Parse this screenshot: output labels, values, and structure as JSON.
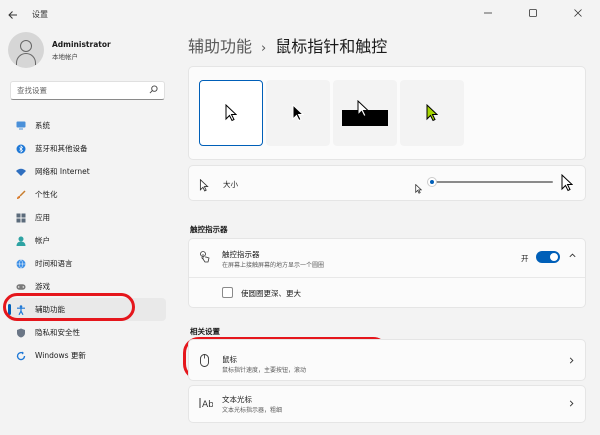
{
  "window": {
    "title": "设置",
    "back_icon": "back-arrow-icon",
    "controls": [
      "minimize-icon",
      "maximize-icon",
      "close-icon"
    ]
  },
  "user": {
    "name": "Administrator",
    "account_type": "本地帐户"
  },
  "search": {
    "placeholder": "查找设置"
  },
  "sidebar": {
    "items": [
      {
        "label": "系统",
        "icon": "system-icon",
        "active": false
      },
      {
        "label": "蓝牙和其他设备",
        "icon": "bluetooth-icon",
        "active": false
      },
      {
        "label": "网络和 Internet",
        "icon": "wifi-icon",
        "active": false
      },
      {
        "label": "个性化",
        "icon": "brush-icon",
        "active": false
      },
      {
        "label": "应用",
        "icon": "apps-icon",
        "active": false
      },
      {
        "label": "帐户",
        "icon": "account-icon",
        "active": false
      },
      {
        "label": "时间和语言",
        "icon": "globe-icon",
        "active": false
      },
      {
        "label": "游戏",
        "icon": "gamepad-icon",
        "active": false
      },
      {
        "label": "辅助功能",
        "icon": "accessibility-icon",
        "active": true
      },
      {
        "label": "隐私和安全性",
        "icon": "shield-icon",
        "active": false
      },
      {
        "label": "Windows 更新",
        "icon": "update-icon",
        "active": false
      }
    ]
  },
  "breadcrumb": {
    "parent": "辅助功能",
    "separator": "›",
    "current": "鼠标指针和触控"
  },
  "cursor_styles": {
    "options": [
      "white-cursor",
      "black-cursor",
      "inverted-cursor",
      "custom-cursor"
    ],
    "selected_index": 0,
    "custom_color": "#a6d600"
  },
  "size": {
    "label": "大小",
    "value_fraction": 0.03
  },
  "touch_indicator_section": {
    "title": "触控指示器",
    "row_title": "触控指示器",
    "row_sub": "在屏幕上接触屏幕的地方显示一个圆圈",
    "toggle_label": "开",
    "toggle_on": true,
    "option_label": "使圆圈更深、更大",
    "option_checked": false
  },
  "related_section": {
    "title": "相关设置",
    "mouse_title": "鼠标",
    "mouse_sub": "鼠标指针速度，主要按钮，滚动",
    "textcursor_title": "文本光标",
    "textcursor_sub": "文本光标指示器，粗细"
  },
  "colors": {
    "accent": "#005fb8",
    "highlight_ring": "#e5161c",
    "background": "#f3f3f3"
  }
}
